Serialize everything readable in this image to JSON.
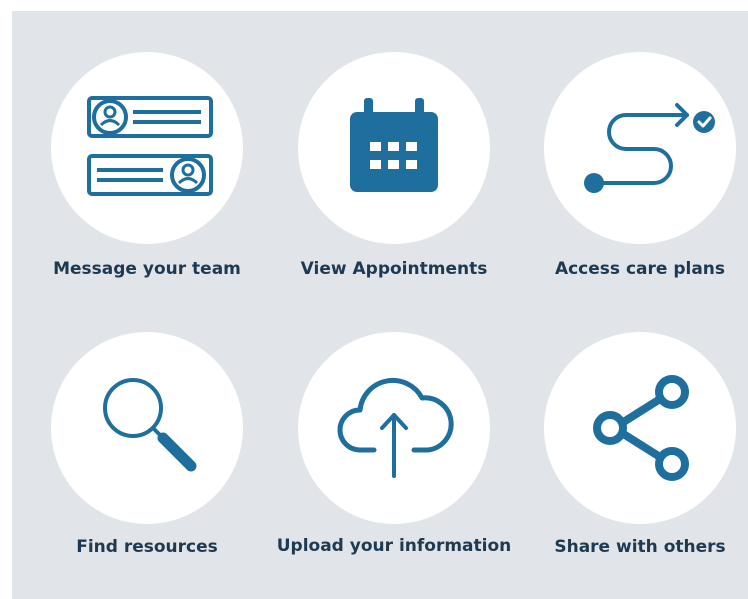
{
  "theme": {
    "background": "#e1e4e8",
    "icon_color": "#1f6f9e",
    "label_color": "#1d3a52"
  },
  "tiles": [
    {
      "label": "Message your team",
      "icon": "message-cards-icon"
    },
    {
      "label": "View Appointments",
      "icon": "calendar-icon"
    },
    {
      "label": "Access care plans",
      "icon": "care-path-icon"
    },
    {
      "label": "Find resources",
      "icon": "search-icon"
    },
    {
      "label": "Upload your information",
      "icon": "cloud-upload-icon"
    },
    {
      "label": "Share with others",
      "icon": "share-icon"
    }
  ]
}
